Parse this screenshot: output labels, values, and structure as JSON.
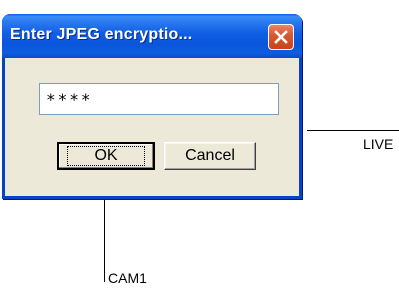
{
  "dialog": {
    "title": "Enter JPEG encryptio...",
    "password_value": "****",
    "ok_label": "OK",
    "cancel_label": "Cancel"
  },
  "background": {
    "live_label": "LIVE",
    "cam_label": "CAM1"
  },
  "icons": {
    "close": "close-icon"
  },
  "colors": {
    "titlebar": "#0a5fe6",
    "close_button": "#d85a32",
    "dialog_face": "#ece9d8"
  }
}
